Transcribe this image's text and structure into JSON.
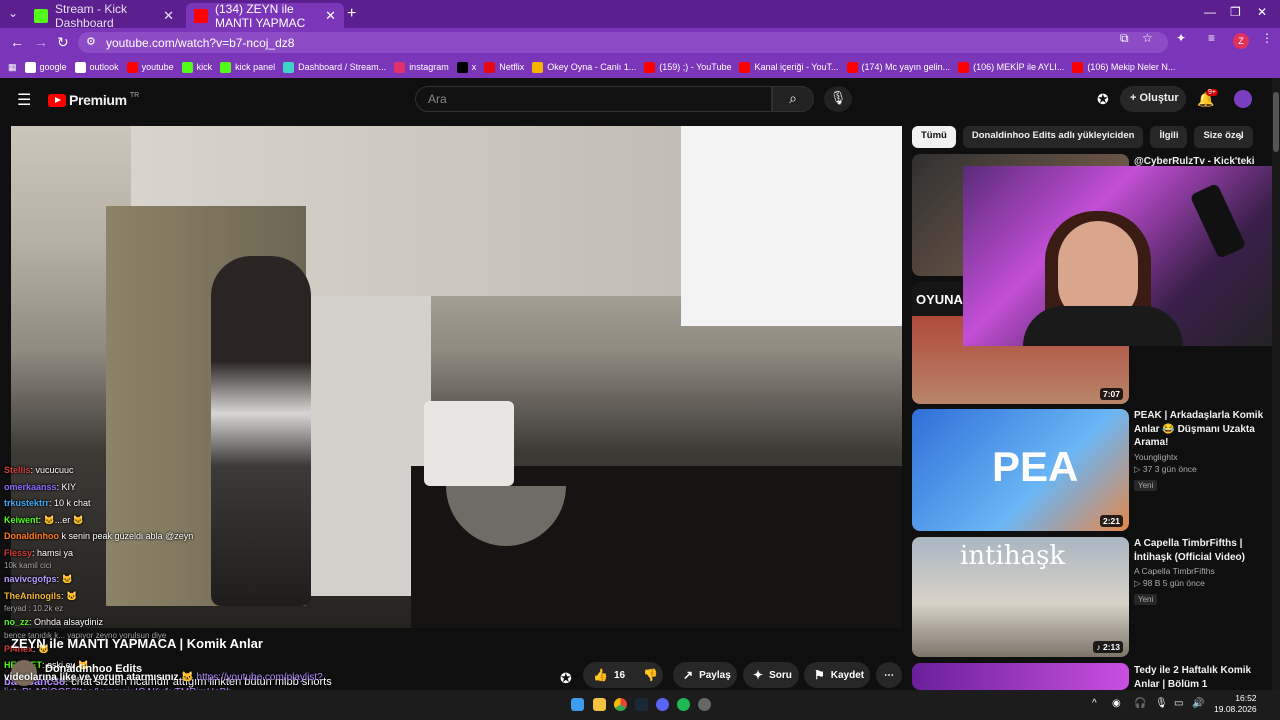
{
  "browser": {
    "tabs": [
      {
        "title": "Stream - Kick Dashboard",
        "favicon_color": "#53fc18"
      },
      {
        "title": "(134) ZEYN ile MANTI YAPMAC",
        "favicon_color": "#ff0000"
      }
    ],
    "url": "youtube.com/watch?v=b7-ncoj_dz8",
    "profile_initial": "Z",
    "bookmarks": [
      {
        "label": "google",
        "color": "#ffffff"
      },
      {
        "label": "outlook",
        "color": "#ffffff"
      },
      {
        "label": "youtube",
        "color": "#ff0000"
      },
      {
        "label": "kick",
        "color": "#53fc18"
      },
      {
        "label": "kick panel",
        "color": "#53fc18"
      },
      {
        "label": "Dashboard / Stream...",
        "color": "#3fd4c8"
      },
      {
        "label": "instagram",
        "color": "#e1306c"
      },
      {
        "label": "x",
        "color": "#000000"
      },
      {
        "label": "Netflix",
        "color": "#e50914"
      },
      {
        "label": "Okey Oyna - Canlı 1...",
        "color": "#f5b400"
      },
      {
        "label": "(159) ;) - YouTube",
        "color": "#ff0000"
      },
      {
        "label": "Kanal içeriği - YouT...",
        "color": "#ff0000"
      },
      {
        "label": "(174) Mc yayın gelin...",
        "color": "#ff0000"
      },
      {
        "label": "(106) MEKİP ile AYLI...",
        "color": "#ff0000"
      },
      {
        "label": "(106) Mekip Neler N...",
        "color": "#ff0000"
      }
    ]
  },
  "youtube": {
    "logo_text": "Premium",
    "logo_region": "TR",
    "search_placeholder": "Ara",
    "create_label": "Oluştur",
    "notif_badge": "9+",
    "video_title": "ZEYN ile MANTI YAPMACA | Komik Anlar",
    "channel_name": "Donaldinhoo Edits",
    "channel_subs": "1 B abone",
    "like_count": "16",
    "share_label": "Paylaş",
    "ask_label": "Soru",
    "save_label": "Kaydet",
    "chips": [
      "Tümü",
      "Donaldinhoo Edits adlı yükleyiciden",
      "İlgili",
      "Size özel"
    ],
    "recommendations": [
      {
        "title": "@CyberRulzTv - Kick'teki Ban",
        "channel": "",
        "meta": "",
        "new": "",
        "duration": ""
      },
      {
        "title": "",
        "channel": "",
        "meta": "",
        "new": "",
        "duration": "7:07",
        "thumb_text": "OYUNA"
      },
      {
        "title": "PEAK | Arkadaşlarla Komik Anlar 😂 Düşmanı Uzakta Arama!",
        "channel": "Younglightx",
        "meta": "▷ 37  3 gün önce",
        "new": "Yeni",
        "duration": "2:21",
        "thumb_text": "PEA"
      },
      {
        "title": "A Capella TimbrFifths | İntihaşk (Official Video)",
        "channel": "A Capella TimbrFifths",
        "meta": "▷ 98 B  5 gün önce",
        "new": "Yeni",
        "duration": "♪ 2:13",
        "thumb_text": "intihaşk"
      },
      {
        "title": "Tedy ile 2 Haftalık Komik Anlar | Bölüm 1",
        "channel": "",
        "meta": "",
        "new": "",
        "duration": ""
      }
    ]
  },
  "chat": [
    {
      "user": "Stellis",
      "msg": ": vucucuuc",
      "color": "#d23b3b"
    },
    {
      "user": "omerkaanss",
      "msg": ": KIY",
      "color": "#8a6cff"
    },
    {
      "user": "trkustektrr",
      "msg": ": 10 k chat",
      "color": "#3fa9f5"
    },
    {
      "user": "Keiwent",
      "msg": ": 🐱...er 🐱",
      "color": "#53fc18"
    },
    {
      "user": "Donaldinhoo",
      "msg": " k senin peak güzeldi abla @zeyn",
      "color": "#ff7a1a"
    },
    {
      "user": "Flessy",
      "msg": ": hamsi ya",
      "color": "#d23b3b"
    },
    {
      "user": "navivcgofps",
      "msg": ": 🐱",
      "color": "#b49cff"
    },
    {
      "user": "TheAninogils",
      "msg": ": 🐱",
      "color": "#f2b632"
    },
    {
      "user": "no_zz",
      "msg": ": Onhda alsaydiniz",
      "color": "#53fc18"
    },
    {
      "user": "Pl4nex",
      "msg": ": 🐱",
      "color": "#d23b3b"
    },
    {
      "user": "HEMNET",
      "msg": ": eski ev 🐱",
      "color": "#53fc18"
    },
    {
      "user": "batubanc38",
      "msg": ": chat sizden ricamdır attığım linkten bütün mlbb shorts",
      "color": "#b48cff"
    }
  ],
  "chat_faint": [
    "10k kamil cici",
    "feryad : 10.2k ez",
    "bence tanıdık k... yapıyor zeyno yorulsun diye"
  ],
  "chat_continuation": {
    "text": "videolarına like ve yorum atarmısınız 🐱",
    "link1": "https://youtube.com/playlist?",
    "link2": "list=PLAPjQO58Itoo&amp;si=IGAKy1vTMRjmUeBb"
  },
  "taskbar": {
    "time": "16:52",
    "date": "19.08.2026"
  }
}
